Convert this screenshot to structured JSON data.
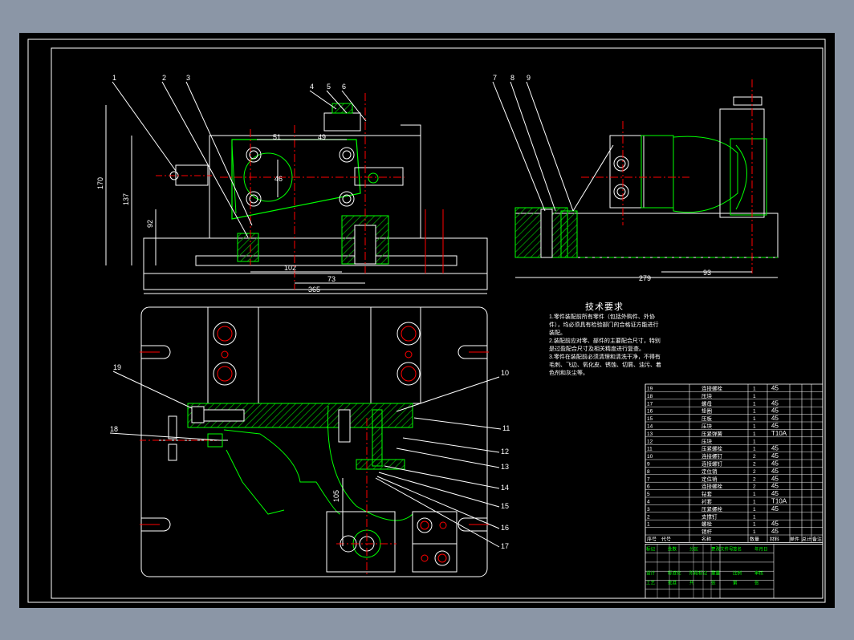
{
  "tech_requirements": {
    "title": "技术要求",
    "lines": [
      "1.零件装配前所有零件（包括外购件、外协",
      "件），均必须具有检验部门的合格证方能进行",
      "装配。",
      "2.装配前应对零、部件的主要配合尺寸，特别",
      "是过盈配合尺寸及相关精度进行复查。",
      "3.零件在装配前必须清理和清洗干净，不得有",
      "毛刺、飞边、氧化皮、锈蚀、切屑、油污、着",
      "色剂和灰尘等。"
    ]
  },
  "dimensions": {
    "top_left": [
      "51",
      "49",
      "46",
      "170",
      "137",
      "92",
      "102",
      "73",
      "365"
    ],
    "top_right": [
      "279",
      "93"
    ],
    "bottom": [
      "105"
    ]
  },
  "balloons": {
    "top_left": [
      "1",
      "2",
      "3",
      "4",
      "5",
      "6"
    ],
    "top_right": [
      "7",
      "8",
      "9"
    ],
    "bottom_left": [
      "19",
      "18"
    ],
    "bottom_right": [
      "10",
      "11",
      "12",
      "13",
      "14",
      "15",
      "16",
      "17"
    ]
  },
  "bom": {
    "rows": [
      {
        "no": "19",
        "name": "连接螺栓",
        "qty": "1",
        "mat": "45"
      },
      {
        "no": "18",
        "name": "压块",
        "qty": "1",
        "mat": ""
      },
      {
        "no": "17",
        "name": "螺母",
        "qty": "1",
        "mat": "45"
      },
      {
        "no": "16",
        "name": "垫圈",
        "qty": "1",
        "mat": "45"
      },
      {
        "no": "15",
        "name": "压板",
        "qty": "1",
        "mat": "45"
      },
      {
        "no": "14",
        "name": "压块",
        "qty": "1",
        "mat": "45"
      },
      {
        "no": "13",
        "name": "压紧弹簧",
        "qty": "1",
        "mat": "T10A"
      },
      {
        "no": "12",
        "name": "压块",
        "qty": "1",
        "mat": ""
      },
      {
        "no": "11",
        "name": "压紧螺栓",
        "qty": "1",
        "mat": "45"
      },
      {
        "no": "10",
        "name": "连接螺钉",
        "qty": "2",
        "mat": "45"
      },
      {
        "no": "9",
        "name": "连接螺钉",
        "qty": "2",
        "mat": "45"
      },
      {
        "no": "8",
        "name": "定位销",
        "qty": "2",
        "mat": "45"
      },
      {
        "no": "7",
        "name": "定位销",
        "qty": "2",
        "mat": "45"
      },
      {
        "no": "6",
        "name": "连接螺栓",
        "qty": "2",
        "mat": "45"
      },
      {
        "no": "5",
        "name": "钻套",
        "qty": "1",
        "mat": "45"
      },
      {
        "no": "4",
        "name": "衬套",
        "qty": "1",
        "mat": "T10A"
      },
      {
        "no": "3",
        "name": "压紧螺栓",
        "qty": "1",
        "mat": "45"
      },
      {
        "no": "2",
        "name": "支撑钉",
        "qty": "1",
        "mat": ""
      },
      {
        "no": "1",
        "name": "螺栓",
        "qty": "1",
        "mat": "45"
      },
      {
        "no": "",
        "name": "销杆",
        "qty": "1",
        "mat": "45"
      }
    ],
    "header": [
      "序号",
      "代号",
      "名称",
      "数量",
      "材料",
      "单件",
      "总计",
      "备注"
    ]
  },
  "title_block": {
    "cells": [
      "标记",
      "处数",
      "分区",
      "更改文件号",
      "签名",
      "年月日",
      "设计",
      "标准化",
      "阶段标记",
      "重量",
      "比例",
      "审核",
      "工艺",
      "批准",
      "共",
      "张",
      "第",
      "张"
    ]
  },
  "colors": {
    "background": "#8b96a6",
    "drawing": "#000000",
    "outline": "#ffffff",
    "part": "#00ff00",
    "hatch": "#00c000",
    "center_line": "#ff0000",
    "text": "#ffffff"
  }
}
